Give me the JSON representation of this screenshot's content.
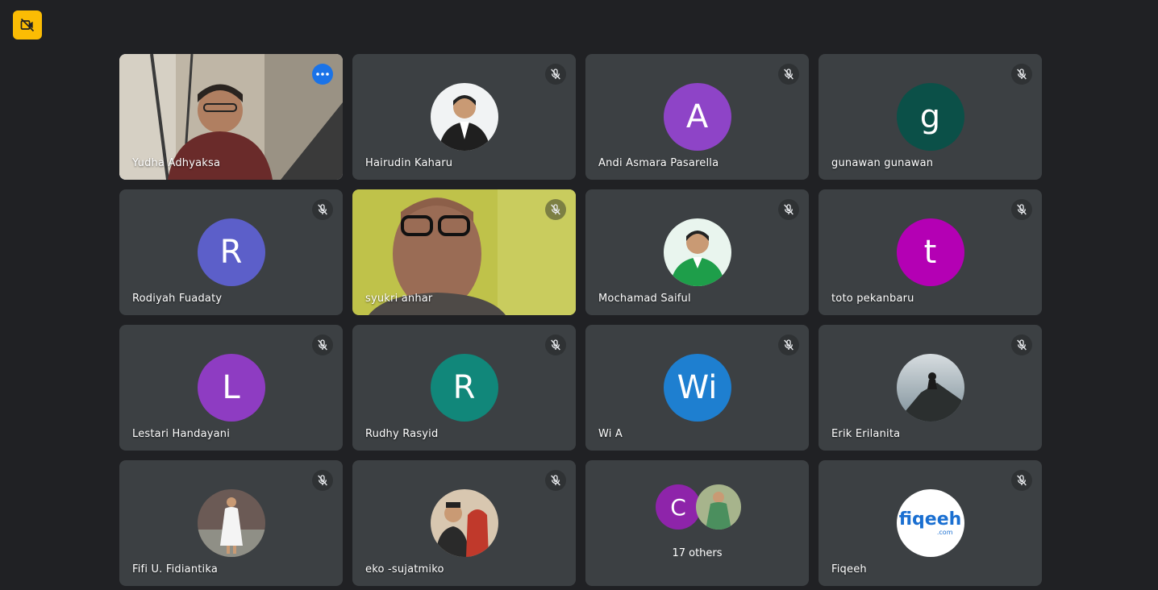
{
  "participants": [
    {
      "name": "Yudha Adhyaksa",
      "avatar": {
        "type": "video"
      },
      "active": true
    },
    {
      "name": "Hairudin Kaharu",
      "avatar": {
        "type": "photo",
        "icon": "person-suit-photo",
        "bg": "#f1f3f4"
      }
    },
    {
      "name": "Andi Asmara Pasarella",
      "avatar": {
        "type": "initial",
        "letter": "A",
        "color": "#8e44c7"
      }
    },
    {
      "name": "gunawan gunawan",
      "avatar": {
        "type": "initial",
        "letter": "g",
        "color": "#0b5048"
      }
    },
    {
      "name": "Rodiyah Fuadaty",
      "avatar": {
        "type": "initial",
        "letter": "R",
        "color": "#5c5fc9"
      }
    },
    {
      "name": "syukri anhar",
      "avatar": {
        "type": "video"
      }
    },
    {
      "name": "Mochamad Saiful",
      "avatar": {
        "type": "photo",
        "icon": "person-green-shirt-photo",
        "bg": "#1e9e4a"
      }
    },
    {
      "name": "toto pekanbaru",
      "avatar": {
        "type": "initial",
        "letter": "t",
        "color": "#b400b4"
      }
    },
    {
      "name": "Lestari Handayani",
      "avatar": {
        "type": "initial",
        "letter": "L",
        "color": "#8e3cc2"
      }
    },
    {
      "name": "Rudhy Rasyid",
      "avatar": {
        "type": "initial",
        "letter": "R",
        "color": "#11877a"
      }
    },
    {
      "name": "Wi A",
      "avatar": {
        "type": "initial",
        "letter": "Wi",
        "color": "#1e7fd0"
      }
    },
    {
      "name": "Erik Erilanita",
      "avatar": {
        "type": "photo",
        "icon": "landscape-photo",
        "bg": "#8aa3b3"
      }
    },
    {
      "name": "Fifi U. Fidiantika",
      "avatar": {
        "type": "photo",
        "icon": "woman-white-dress-photo",
        "bg": "#6b5a55"
      }
    },
    {
      "name": "eko -sujatmiko",
      "avatar": {
        "type": "photo",
        "icon": "couple-photo",
        "bg": "#c0392b"
      }
    },
    {
      "name": "",
      "avatar": {
        "type": "others",
        "letter": "C",
        "label": "17 others"
      }
    },
    {
      "name": "Fiqeeh",
      "avatar": {
        "type": "logo",
        "text": "fiqeeh",
        "sub": ".com",
        "color": "#1a6fd1",
        "bg": "#ffffff"
      }
    }
  ],
  "icons": {
    "muted": "mic-off-icon",
    "options": "more-options-icon",
    "top_badge": "video-off-icon"
  },
  "colors": {
    "background": "#202124",
    "tile": "#3c4043",
    "active_border": "#8ab4f8",
    "badge": "#fbbc04"
  }
}
